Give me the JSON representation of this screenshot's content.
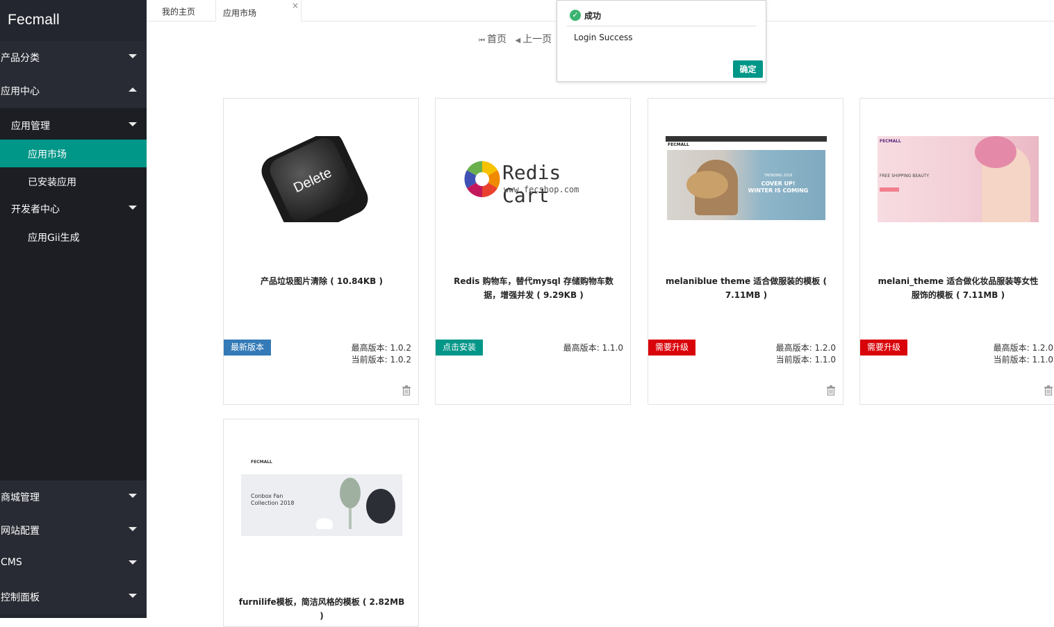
{
  "brand": "Fecmall",
  "sidebar": {
    "top_items": [
      {
        "label": "产品分类"
      },
      {
        "label": "应用中心"
      }
    ],
    "sub_items": [
      {
        "label": "应用管理"
      },
      {
        "label": "应用市场"
      },
      {
        "label": "已安装应用"
      },
      {
        "label": "开发者中心"
      },
      {
        "label": "应用Gii生成"
      }
    ],
    "bottom_items": [
      {
        "label": "商城管理"
      },
      {
        "label": "网站配置"
      },
      {
        "label": "CMS"
      },
      {
        "label": "控制面板"
      }
    ]
  },
  "tabs": [
    {
      "label": "我的主页"
    },
    {
      "label": "应用市场"
    }
  ],
  "tab_close": "×",
  "pager": {
    "first": "首页",
    "prev": "上一页"
  },
  "cards": [
    {
      "title": "产品垃圾图片清除 ( 10.84KB )",
      "badge": "最新版本",
      "badge_color": "#337ab7",
      "latest": "最高版本: 1.0.2",
      "current": "当前版本: 1.0.2",
      "thumb": "delete-key-image"
    },
    {
      "title": "Redis 购物车，替代mysql 存储购物车数据，增强并发 ( 9.29KB )",
      "badge": "点击安装",
      "badge_color": "#009688",
      "latest": "最高版本: 1.1.0",
      "current": "",
      "thumb": "redis-cart-logo",
      "logo_title": "Redis Cart",
      "logo_sub": "www.fecshop.com"
    },
    {
      "title": "melaniblue theme 适合做服装的模板 ( 7.11MB )",
      "badge": "需要升级",
      "badge_color": "#d9030a",
      "latest": "最高版本: 1.2.0",
      "current": "当前版本: 1.1.0",
      "thumb": "melaniblue-screenshot",
      "shot_logo": "FECMALL",
      "shot_text1": "TRENDING 2018",
      "shot_text2": "COVER UP!",
      "shot_text3": "WINTER IS COMING"
    },
    {
      "title": "melani_theme 适合做化妆品服装等女性服饰的模板 ( 7.11MB )",
      "badge": "需要升级",
      "badge_color": "#d9030a",
      "latest": "最高版本: 1.2.0",
      "current": "当前版本: 1.1.0",
      "thumb": "melani-screenshot",
      "shot_logo": "FECMALL",
      "shot_text1": "FREE SHIPPING BEAUTY"
    },
    {
      "title": "furnilife模板，简洁风格的模板 ( 2.82MB )",
      "badge": "",
      "badge_color": "",
      "latest": "",
      "current": "",
      "thumb": "furnilife-screenshot",
      "shot_logo": "FECMALL",
      "shot_text1": "Conbox Fan",
      "shot_text2": "Collection 2018"
    }
  ],
  "dialog": {
    "title": "成功",
    "message": "Login Success",
    "ok": "确定"
  }
}
